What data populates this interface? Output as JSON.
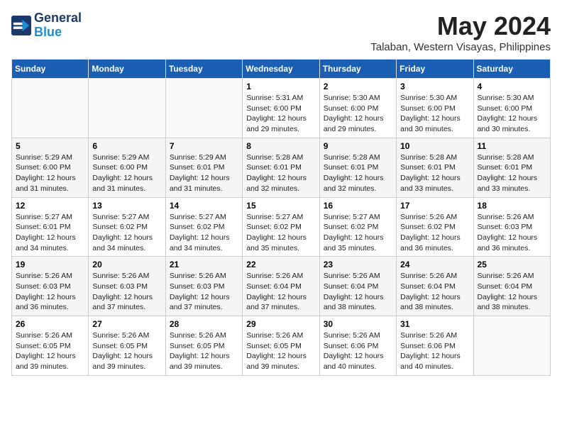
{
  "header": {
    "logo_line1": "General",
    "logo_line2": "Blue",
    "month_year": "May 2024",
    "location": "Talaban, Western Visayas, Philippines"
  },
  "days_of_week": [
    "Sunday",
    "Monday",
    "Tuesday",
    "Wednesday",
    "Thursday",
    "Friday",
    "Saturday"
  ],
  "weeks": [
    [
      {
        "day": "",
        "info": ""
      },
      {
        "day": "",
        "info": ""
      },
      {
        "day": "",
        "info": ""
      },
      {
        "day": "1",
        "info": "Sunrise: 5:31 AM\nSunset: 6:00 PM\nDaylight: 12 hours and 29 minutes."
      },
      {
        "day": "2",
        "info": "Sunrise: 5:30 AM\nSunset: 6:00 PM\nDaylight: 12 hours and 29 minutes."
      },
      {
        "day": "3",
        "info": "Sunrise: 5:30 AM\nSunset: 6:00 PM\nDaylight: 12 hours and 30 minutes."
      },
      {
        "day": "4",
        "info": "Sunrise: 5:30 AM\nSunset: 6:00 PM\nDaylight: 12 hours and 30 minutes."
      }
    ],
    [
      {
        "day": "5",
        "info": "Sunrise: 5:29 AM\nSunset: 6:00 PM\nDaylight: 12 hours and 31 minutes."
      },
      {
        "day": "6",
        "info": "Sunrise: 5:29 AM\nSunset: 6:00 PM\nDaylight: 12 hours and 31 minutes."
      },
      {
        "day": "7",
        "info": "Sunrise: 5:29 AM\nSunset: 6:01 PM\nDaylight: 12 hours and 31 minutes."
      },
      {
        "day": "8",
        "info": "Sunrise: 5:28 AM\nSunset: 6:01 PM\nDaylight: 12 hours and 32 minutes."
      },
      {
        "day": "9",
        "info": "Sunrise: 5:28 AM\nSunset: 6:01 PM\nDaylight: 12 hours and 32 minutes."
      },
      {
        "day": "10",
        "info": "Sunrise: 5:28 AM\nSunset: 6:01 PM\nDaylight: 12 hours and 33 minutes."
      },
      {
        "day": "11",
        "info": "Sunrise: 5:28 AM\nSunset: 6:01 PM\nDaylight: 12 hours and 33 minutes."
      }
    ],
    [
      {
        "day": "12",
        "info": "Sunrise: 5:27 AM\nSunset: 6:01 PM\nDaylight: 12 hours and 34 minutes."
      },
      {
        "day": "13",
        "info": "Sunrise: 5:27 AM\nSunset: 6:02 PM\nDaylight: 12 hours and 34 minutes."
      },
      {
        "day": "14",
        "info": "Sunrise: 5:27 AM\nSunset: 6:02 PM\nDaylight: 12 hours and 34 minutes."
      },
      {
        "day": "15",
        "info": "Sunrise: 5:27 AM\nSunset: 6:02 PM\nDaylight: 12 hours and 35 minutes."
      },
      {
        "day": "16",
        "info": "Sunrise: 5:27 AM\nSunset: 6:02 PM\nDaylight: 12 hours and 35 minutes."
      },
      {
        "day": "17",
        "info": "Sunrise: 5:26 AM\nSunset: 6:02 PM\nDaylight: 12 hours and 36 minutes."
      },
      {
        "day": "18",
        "info": "Sunrise: 5:26 AM\nSunset: 6:03 PM\nDaylight: 12 hours and 36 minutes."
      }
    ],
    [
      {
        "day": "19",
        "info": "Sunrise: 5:26 AM\nSunset: 6:03 PM\nDaylight: 12 hours and 36 minutes."
      },
      {
        "day": "20",
        "info": "Sunrise: 5:26 AM\nSunset: 6:03 PM\nDaylight: 12 hours and 37 minutes."
      },
      {
        "day": "21",
        "info": "Sunrise: 5:26 AM\nSunset: 6:03 PM\nDaylight: 12 hours and 37 minutes."
      },
      {
        "day": "22",
        "info": "Sunrise: 5:26 AM\nSunset: 6:04 PM\nDaylight: 12 hours and 37 minutes."
      },
      {
        "day": "23",
        "info": "Sunrise: 5:26 AM\nSunset: 6:04 PM\nDaylight: 12 hours and 38 minutes."
      },
      {
        "day": "24",
        "info": "Sunrise: 5:26 AM\nSunset: 6:04 PM\nDaylight: 12 hours and 38 minutes."
      },
      {
        "day": "25",
        "info": "Sunrise: 5:26 AM\nSunset: 6:04 PM\nDaylight: 12 hours and 38 minutes."
      }
    ],
    [
      {
        "day": "26",
        "info": "Sunrise: 5:26 AM\nSunset: 6:05 PM\nDaylight: 12 hours and 39 minutes."
      },
      {
        "day": "27",
        "info": "Sunrise: 5:26 AM\nSunset: 6:05 PM\nDaylight: 12 hours and 39 minutes."
      },
      {
        "day": "28",
        "info": "Sunrise: 5:26 AM\nSunset: 6:05 PM\nDaylight: 12 hours and 39 minutes."
      },
      {
        "day": "29",
        "info": "Sunrise: 5:26 AM\nSunset: 6:05 PM\nDaylight: 12 hours and 39 minutes."
      },
      {
        "day": "30",
        "info": "Sunrise: 5:26 AM\nSunset: 6:06 PM\nDaylight: 12 hours and 40 minutes."
      },
      {
        "day": "31",
        "info": "Sunrise: 5:26 AM\nSunset: 6:06 PM\nDaylight: 12 hours and 40 minutes."
      },
      {
        "day": "",
        "info": ""
      }
    ]
  ]
}
